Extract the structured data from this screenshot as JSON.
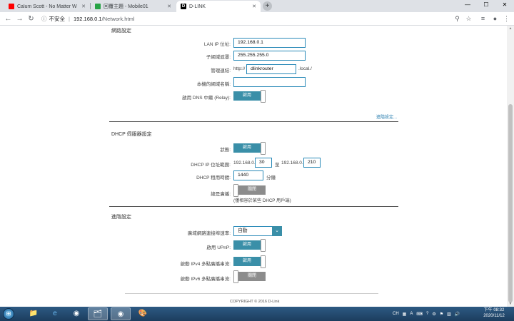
{
  "browser": {
    "tabs": [
      {
        "title": "Calum Scott - No Matter W",
        "favicon_color": "#ff0000"
      },
      {
        "title": "回覆主題 - Mobile01",
        "favicon_color": "#27a345"
      },
      {
        "title": "D-LINK",
        "favicon_color": "#000000"
      }
    ],
    "new_tab": "+",
    "win_controls": {
      "minimize": "—",
      "maximize": "☐",
      "close": "✕"
    },
    "nav": {
      "back": "←",
      "forward": "→",
      "reload": "↻"
    },
    "address": {
      "security": "不安全",
      "host": "192.168.0.1",
      "path": "/Network.html"
    }
  },
  "network": {
    "title": "網路設定",
    "lan_ip_label": "LAN IP 位址:",
    "lan_ip": "192.168.0.1",
    "subnet_label": "子網域遮罩:",
    "subnet": "255.255.255.0",
    "mgmt_link_label": "管理連結:",
    "mgmt_prefix": "http://",
    "mgmt_value": "dlinkrouter",
    "mgmt_suffix": ".local./",
    "local_domain_label": "本機的網域名稱:",
    "local_domain": "",
    "dns_relay_label": "啟用 DNS 中繼 (Relay):",
    "dns_relay_state": "啟用",
    "advanced_link": "進階設定..."
  },
  "dhcp": {
    "title": "DHCP 伺服器設定",
    "status_label": "狀態:",
    "status_state": "啟用",
    "range_label": "DHCP IP 位址範圍:",
    "range_prefix1": "192.168.0.",
    "range_start": "30",
    "range_to": "至",
    "range_prefix2": "192.168.0.",
    "range_end": "210",
    "lease_label": "DHCP 租用時間:",
    "lease_value": "1440",
    "lease_unit": "分鐘",
    "broadcast_label": "總是廣播:",
    "broadcast_state": "關閉",
    "broadcast_hint": "(僅相容於某些 DHCP 用戶端)"
  },
  "advanced": {
    "title": "進階設定",
    "wan_speed_label": "廣域網路連接埠速率:",
    "wan_speed_value": "自動",
    "upnp_label": "啟用 UPnP:",
    "upnp_state": "啟用",
    "ipv4_mc_label": "啟動 IPv4 多點廣播串流:",
    "ipv4_mc_state": "啟用",
    "ipv6_mc_label": "啟動 IPv6 多點廣播串流:",
    "ipv6_mc_state": "關閉"
  },
  "footer": {
    "copyright": "COPYRIGHT © 2016 D-Link"
  },
  "taskbar": {
    "tray_lang": "CH",
    "clock_time": "下午 08:32",
    "clock_date": "2020/11/12"
  }
}
